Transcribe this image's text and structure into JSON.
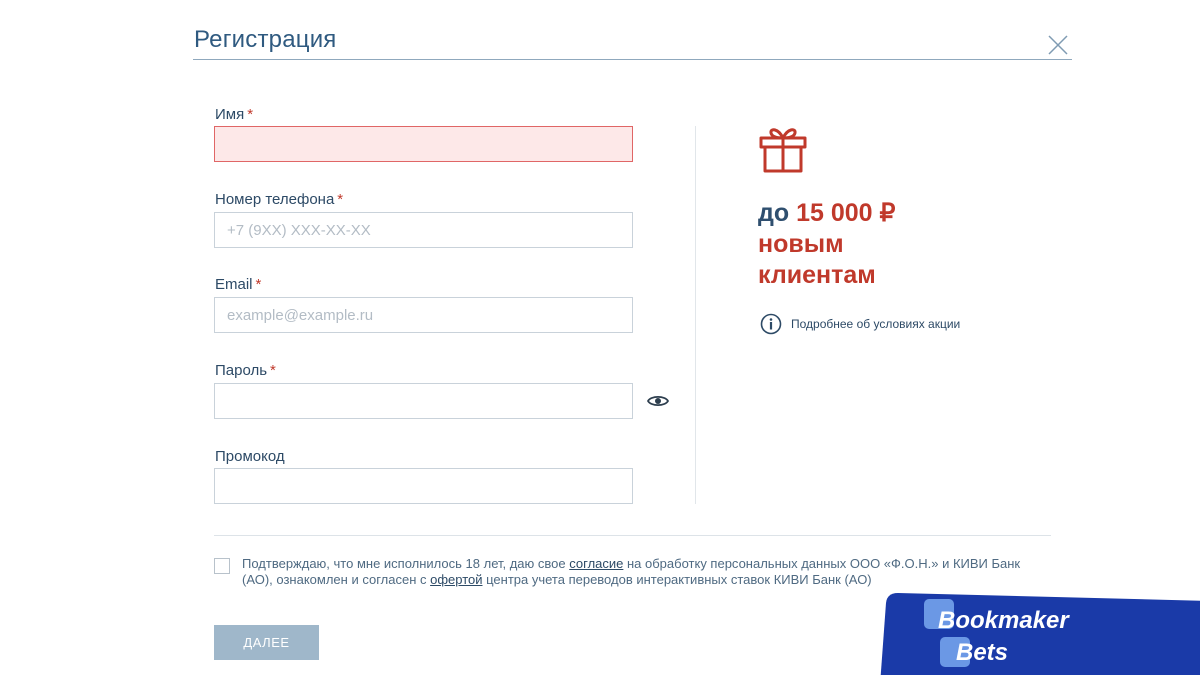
{
  "modal": {
    "title": "Регистрация",
    "close_icon": "close-icon"
  },
  "form": {
    "name": {
      "label": "Имя",
      "required_mark": "*",
      "value": "",
      "placeholder": "",
      "state": "error"
    },
    "phone": {
      "label": "Номер телефона",
      "required_mark": "*",
      "value": "",
      "placeholder": "+7 (9XX) XXX-XX-XX"
    },
    "email": {
      "label": "Email",
      "required_mark": "*",
      "value": "",
      "placeholder": "example@example.ru"
    },
    "password": {
      "label": "Пароль",
      "required_mark": "*",
      "value": "",
      "placeholder": "",
      "toggle_icon": "eye-icon"
    },
    "promo": {
      "label": "Промокод",
      "value": "",
      "placeholder": ""
    }
  },
  "bonus": {
    "icon": "gift-icon",
    "prefix": "до",
    "amount": "15 000 ₽",
    "line2": "новым",
    "line3": "клиентам",
    "info_icon": "info-icon",
    "info_link": "Подробнее об условиях акции"
  },
  "consent": {
    "checked": false,
    "text_1": "Подтверждаю, что мне исполнилось 18 лет, даю свое ",
    "link_1": "согласие",
    "text_2": " на обработку персональных данных ООО «Ф.О.Н.» и КИВИ Банк (АО), ознакомлен и согласен с ",
    "link_2": "офертой",
    "text_3": " центра учета переводов интерактивных ставок КИВИ Банк (АО)"
  },
  "submit": {
    "label": "ДАЛЕЕ"
  },
  "watermark": {
    "line1": "Bookmaker",
    "line2": "Bets"
  },
  "colors": {
    "accent_red": "#c0392b",
    "primary_blue": "#2f5a80",
    "button_disabled": "#9fb7ca",
    "error_bg": "#fde8e8",
    "watermark_bg": "#1a3aa8"
  }
}
